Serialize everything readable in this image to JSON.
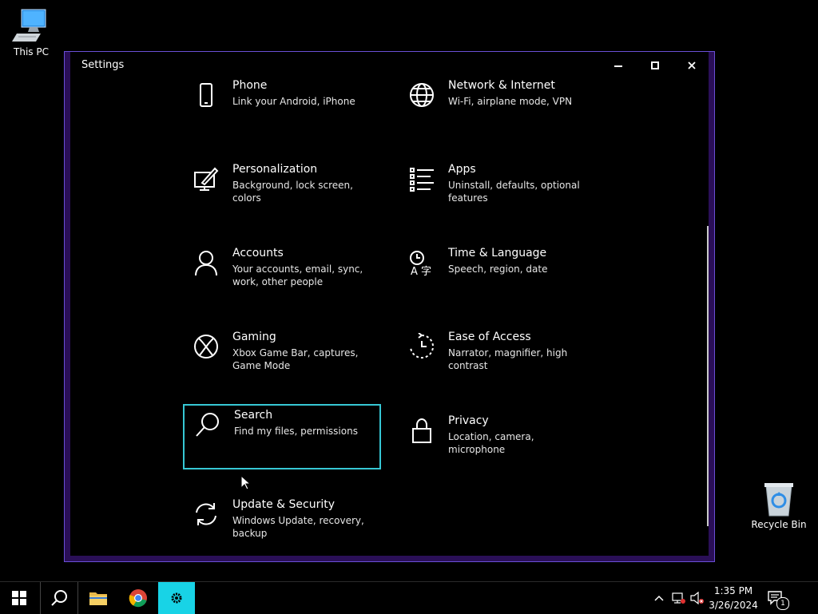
{
  "desktop": {
    "this_pc_label": "This PC",
    "recycle_bin_label": "Recycle Bin"
  },
  "window": {
    "title": "Settings"
  },
  "settings_tiles": [
    {
      "icon": "phone-icon",
      "title": "Phone",
      "desc": "Link your Android, iPhone"
    },
    {
      "icon": "globe-icon",
      "title": "Network & Internet",
      "desc": "Wi-Fi, airplane mode, VPN"
    },
    {
      "icon": "personalization-icon",
      "title": "Personalization",
      "desc": "Background, lock screen, colors"
    },
    {
      "icon": "apps-icon",
      "title": "Apps",
      "desc": "Uninstall, defaults, optional features"
    },
    {
      "icon": "person-icon",
      "title": "Accounts",
      "desc": "Your accounts, email, sync, work, other people"
    },
    {
      "icon": "time-language-icon",
      "title": "Time & Language",
      "desc": "Speech, region, date"
    },
    {
      "icon": "xbox-icon",
      "title": "Gaming",
      "desc": "Xbox Game Bar, captures, Game Mode"
    },
    {
      "icon": "ease-of-access-icon",
      "title": "Ease of Access",
      "desc": "Narrator, magnifier, high contrast"
    },
    {
      "icon": "search-icon",
      "title": "Search",
      "desc": "Find my files, permissions"
    },
    {
      "icon": "lock-icon",
      "title": "Privacy",
      "desc": "Location, camera, microphone"
    },
    {
      "icon": "sync-icon",
      "title": "Update & Security",
      "desc": "Windows Update, recovery, backup"
    }
  ],
  "taskbar": {
    "time": "1:35 PM",
    "date": "3/26/2024",
    "notification_count": "1"
  },
  "colors": {
    "accent": "#18d3e6",
    "window_frame": "#2a0f57",
    "focus_border": "#36c7d4"
  }
}
